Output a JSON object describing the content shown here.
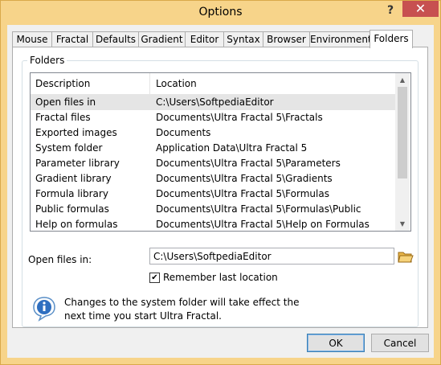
{
  "window": {
    "title": "Options",
    "help_glyph": "?",
    "close_glyph": "✕"
  },
  "tabs": [
    {
      "label": "Mouse"
    },
    {
      "label": "Fractal"
    },
    {
      "label": "Defaults"
    },
    {
      "label": "Gradient"
    },
    {
      "label": "Editor"
    },
    {
      "label": "Syntax"
    },
    {
      "label": "Browser"
    },
    {
      "label": "Environment"
    },
    {
      "label": "Folders",
      "active": true
    }
  ],
  "folders": {
    "group_label": "Folders",
    "columns": [
      "Description",
      "Location"
    ],
    "rows": [
      {
        "description": "Open files in",
        "location": "C:\\Users\\SoftpediaEditor"
      },
      {
        "description": "Fractal files",
        "location": "Documents\\Ultra Fractal 5\\Fractals"
      },
      {
        "description": "Exported images",
        "location": "Documents"
      },
      {
        "description": "System folder",
        "location": "Application Data\\Ultra Fractal 5"
      },
      {
        "description": "Parameter library",
        "location": "Documents\\Ultra Fractal 5\\Parameters"
      },
      {
        "description": "Gradient library",
        "location": "Documents\\Ultra Fractal 5\\Gradients"
      },
      {
        "description": "Formula library",
        "location": "Documents\\Ultra Fractal 5\\Formulas"
      },
      {
        "description": "Public formulas",
        "location": "Documents\\Ultra Fractal 5\\Formulas\\Public"
      },
      {
        "description": "Help on formulas",
        "location": "Documents\\Ultra Fractal 5\\Help on Formulas"
      }
    ],
    "open_files_label": "Open files in:",
    "open_files_value": "C:\\Users\\SoftpediaEditor",
    "remember_label": "Remember last location",
    "remember_checked": true,
    "info_text": "Changes to the system folder will take effect the next time you start Ultra Fractal."
  },
  "buttons": {
    "ok": "OK",
    "cancel": "Cancel"
  },
  "colors": {
    "titlebar": "#f7d48a",
    "close": "#c75050",
    "selection": "#e5e5e5"
  }
}
